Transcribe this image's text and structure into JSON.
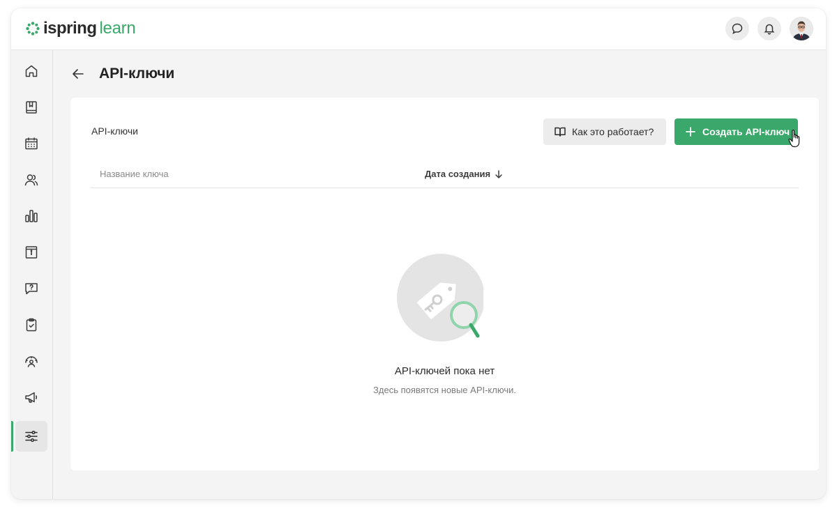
{
  "header": {
    "logo_part1": "ispring",
    "logo_part2": "learn",
    "brand_color": "#3aa86a",
    "actions": [
      {
        "icon": "chat-icon"
      },
      {
        "icon": "bell-icon"
      },
      {
        "icon": "user-avatar"
      }
    ]
  },
  "sidebar": {
    "items": [
      {
        "id": "home",
        "icon": "home-icon"
      },
      {
        "id": "courses",
        "icon": "book-icon"
      },
      {
        "id": "calendar",
        "icon": "calendar-icon"
      },
      {
        "id": "users",
        "icon": "users-icon"
      },
      {
        "id": "reports",
        "icon": "bar-chart-icon"
      },
      {
        "id": "info",
        "icon": "info-page-icon"
      },
      {
        "id": "questions",
        "icon": "question-chat-icon"
      },
      {
        "id": "tasks",
        "icon": "clipboard-check-icon"
      },
      {
        "id": "talent",
        "icon": "gauge-user-icon"
      },
      {
        "id": "announcements",
        "icon": "megaphone-icon"
      },
      {
        "id": "settings",
        "icon": "sliders-icon",
        "active": true
      }
    ]
  },
  "page": {
    "title": "API-ключи"
  },
  "card": {
    "label": "API-ключи",
    "howto_button": "Как это работает?",
    "create_button": "Создать API-ключ",
    "columns": {
      "name": "Название ключа",
      "date": "Дата создания"
    },
    "empty_title": "API-ключей пока нет",
    "empty_subtitle": "Здесь появятся новые API-ключи."
  }
}
